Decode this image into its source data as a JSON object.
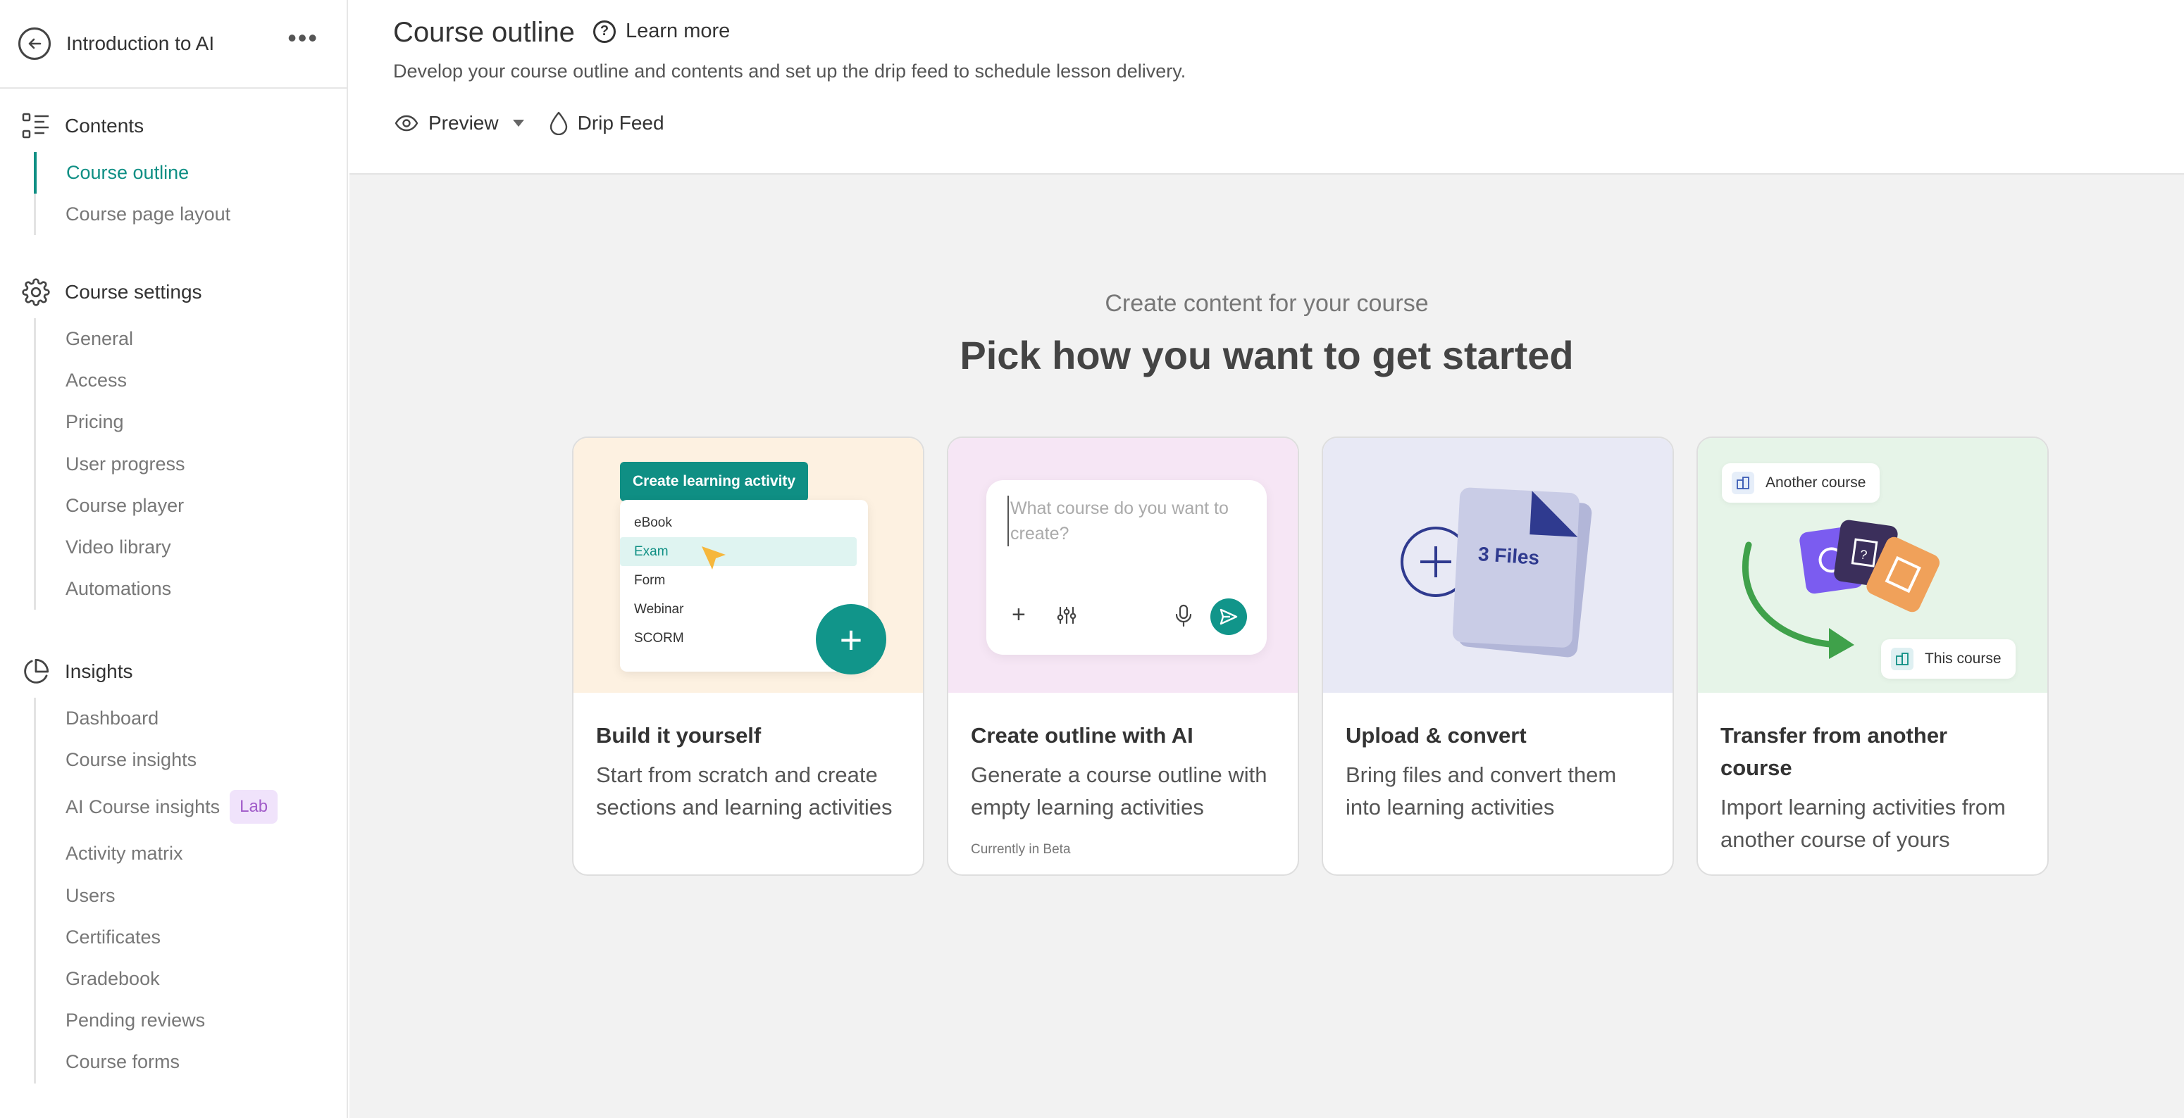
{
  "sidebar": {
    "course_title": "Introduction to AI",
    "sections": [
      {
        "label": "Contents",
        "icon": "list-icon",
        "items": [
          "Course outline",
          "Course page layout"
        ]
      },
      {
        "label": "Course settings",
        "icon": "gear-icon",
        "items": [
          "General",
          "Access",
          "Pricing",
          "User progress",
          "Course player",
          "Video library",
          "Automations"
        ]
      },
      {
        "label": "Insights",
        "icon": "pie-chart-icon",
        "items": [
          "Dashboard",
          "Course insights",
          "AI Course insights",
          "Activity matrix",
          "Users",
          "Certificates",
          "Gradebook",
          "Pending reviews",
          "Course forms"
        ],
        "badge": "Lab"
      }
    ],
    "active_item": "Course outline"
  },
  "header": {
    "title": "Course outline",
    "learn_more": "Learn more",
    "subtitle": "Develop your course outline and contents and set up the drip feed to schedule lesson delivery.",
    "preview_label": "Preview",
    "drip_feed_label": "Drip Feed"
  },
  "hero": {
    "subtitle": "Create content for your course",
    "title": "Pick how you want to get started"
  },
  "cards": [
    {
      "title": "Build it yourself",
      "desc": "Start from scratch and create sections and learning activities",
      "art": {
        "button": "Create learning activity",
        "menu": [
          "eBook",
          "Exam",
          "Form",
          "Webinar",
          "SCORM"
        ]
      }
    },
    {
      "title": "Create outline with AI",
      "desc": "Generate a course outline with empty learning activities",
      "note": "Currently in Beta",
      "art": {
        "placeholder": "What course do you want to create?"
      }
    },
    {
      "title": "Upload & convert",
      "desc": "Bring files and convert them into learning activities",
      "art": {
        "files_label": "3 Files"
      }
    },
    {
      "title": "Transfer from another course",
      "desc": "Import learning activities from another course of yours",
      "art": {
        "from_label": "Another course",
        "to_label": "This course"
      }
    }
  ],
  "colors": {
    "accent": "#0f8f84",
    "card1_bg": "#fdf1e1",
    "card2_bg": "#f6e6f5",
    "card3_bg": "#e8e9f5",
    "card4_bg": "#e6f4e8"
  }
}
